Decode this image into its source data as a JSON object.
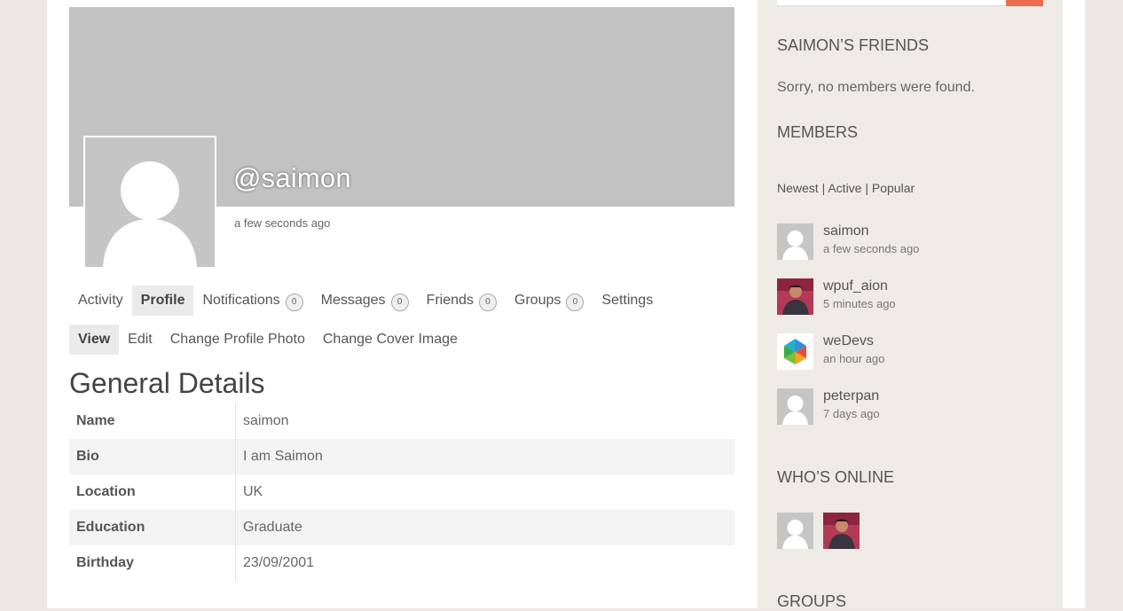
{
  "profile": {
    "username": "@saimon",
    "last_active": "a few seconds ago"
  },
  "nav": {
    "items": [
      {
        "label": "Activity"
      },
      {
        "label": "Profile"
      },
      {
        "label": "Notifications",
        "count": "0"
      },
      {
        "label": "Messages",
        "count": "0"
      },
      {
        "label": "Friends",
        "count": "0"
      },
      {
        "label": "Groups",
        "count": "0"
      },
      {
        "label": "Settings"
      }
    ],
    "active": "Profile"
  },
  "subnav": {
    "items": [
      {
        "label": "View"
      },
      {
        "label": "Edit"
      },
      {
        "label": "Change Profile Photo"
      },
      {
        "label": "Change Cover Image"
      }
    ],
    "active": "View"
  },
  "details": {
    "title": "General Details",
    "rows": [
      {
        "label": "Name",
        "value": "saimon"
      },
      {
        "label": "Bio",
        "value": "I am Saimon"
      },
      {
        "label": "Location",
        "value": "UK"
      },
      {
        "label": "Education",
        "value": "Graduate"
      },
      {
        "label": "Birthday",
        "value": "23/09/2001"
      }
    ]
  },
  "sidebar": {
    "friends_title": "SAIMON’S FRIENDS",
    "friends_empty": "Sorry, no members were found.",
    "members_title": "MEMBERS",
    "filters": {
      "newest": "Newest",
      "active": "Active",
      "popular": "Popular",
      "sep": "|"
    },
    "members": [
      {
        "name": "saimon",
        "time": "a few seconds ago",
        "avatar": "default-avatar-icon"
      },
      {
        "name": "wpuf_aion",
        "time": "5 minutes ago",
        "avatar": "photo-avatar"
      },
      {
        "name": "weDevs",
        "time": "an hour ago",
        "avatar": "wedevs-logo"
      },
      {
        "name": "peterpan",
        "time": "7 days ago",
        "avatar": "default-avatar-icon"
      }
    ],
    "online_title": "WHO’S ONLINE",
    "groups_title": "GROUPS"
  },
  "colors": {
    "accent": "#ef6c50",
    "cover": "#c2c2c2",
    "page_bg": "#ece9e5"
  }
}
